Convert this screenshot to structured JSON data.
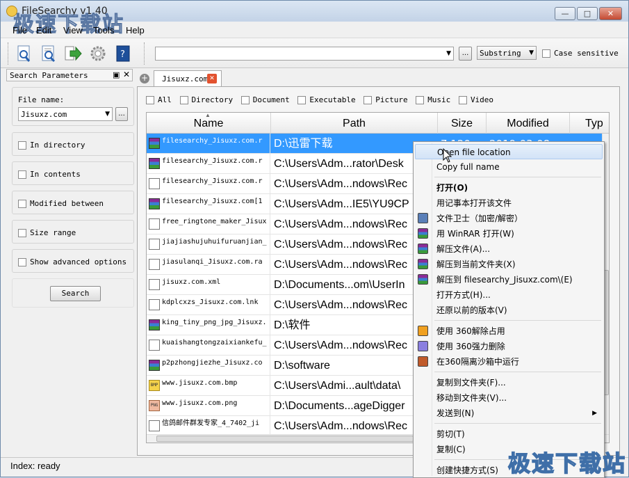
{
  "window": {
    "title": "FileSearchy v1.40",
    "watermark": "极速下载站",
    "buttons": {
      "minimize": "—",
      "maximize": "□",
      "close": "✕"
    }
  },
  "menu": [
    "File",
    "Edit",
    "View",
    "Tools",
    "Help"
  ],
  "toolbar": {
    "icons": [
      "search-file-icon",
      "search-content-icon",
      "export-arrow-icon",
      "settings-gear-icon",
      "help-book-icon"
    ],
    "search_value": "",
    "browse_label": "...",
    "match_mode": "Substring",
    "case_sensitive_label": "Case sensitive"
  },
  "left_panel": {
    "header": "Search Parameters",
    "file_name_label": "File name:",
    "file_name_value": "Jisuxz.com",
    "browse_label": "...",
    "options": [
      "In directory",
      "In contents",
      "Modified between",
      "Size range",
      "Show advanced options"
    ],
    "search_button": "Search"
  },
  "tabs": {
    "add_label": "+",
    "active_tab": "Jisuxz.com",
    "close_label": "✕"
  },
  "filters": [
    "All",
    "Directory",
    "Document",
    "Executable",
    "Picture",
    "Music",
    "Video"
  ],
  "columns": {
    "name": "Name",
    "path": "Path",
    "size": "Size",
    "modified": "Modified",
    "type": "Typ"
  },
  "rows": [
    {
      "name": "filesearchy_Jisuxz.com.r",
      "path": "D:\\迅雷下载",
      "size": "7,120",
      "modified": "2019-03-08",
      "icon": "rar"
    },
    {
      "name": "filesearchy_Jisuxz.com.r",
      "path": "C:\\Users\\Adm...rator\\Desk",
      "size": "",
      "modified": "",
      "icon": "rar"
    },
    {
      "name": "filesearchy_Jisuxz.com.r",
      "path": "C:\\Users\\Adm...ndows\\Rec",
      "size": "",
      "modified": "",
      "icon": "lnk"
    },
    {
      "name": "filesearchy_Jisuxz.com[1",
      "path": "C:\\Users\\Adm...IE5\\YU9CP",
      "size": "",
      "modified": "",
      "icon": "rar"
    },
    {
      "name": "free_ringtone_maker_Jisux",
      "path": "C:\\Users\\Adm...ndows\\Rec",
      "size": "",
      "modified": "",
      "icon": "lnk"
    },
    {
      "name": "jiajiashujuhuifuruanjian_",
      "path": "C:\\Users\\Adm...ndows\\Rec",
      "size": "",
      "modified": "",
      "icon": "lnk"
    },
    {
      "name": "jiasulanqi_Jisuxz.com.ra",
      "path": "C:\\Users\\Adm...ndows\\Rec",
      "size": "",
      "modified": "",
      "icon": "lnk"
    },
    {
      "name": "jisuxz.com.xml",
      "path": "D:\\Documents...om\\UserIn",
      "size": "",
      "modified": "",
      "icon": "xml"
    },
    {
      "name": "kdplcxzs_Jisuxz.com.lnk",
      "path": "C:\\Users\\Adm...ndows\\Rec",
      "size": "",
      "modified": "",
      "icon": "lnk"
    },
    {
      "name": "king_tiny_png_jpg_Jisuxz.",
      "path": "D:\\软件",
      "size": "",
      "modified": "",
      "icon": "rar"
    },
    {
      "name": "kuaishangtongzaixiankefu_",
      "path": "C:\\Users\\Adm...ndows\\Rec",
      "size": "",
      "modified": "",
      "icon": "lnk"
    },
    {
      "name": "p2pzhongjiezhe_Jisuxz.co",
      "path": "D:\\software",
      "size": "",
      "modified": "",
      "icon": "rar"
    },
    {
      "name": "www.jisuxz.com.bmp",
      "path": "C:\\Users\\Admi...ault\\data\\",
      "size": "",
      "modified": "",
      "icon": "bmp"
    },
    {
      "name": "www.jisuxz.com.png",
      "path": "D:\\Documents...ageDigger",
      "size": "",
      "modified": "",
      "icon": "png"
    },
    {
      "name": "信鸽邮件群发专家_4_7402_ji",
      "path": "C:\\Users\\Adm...ndows\\Rec",
      "size": "",
      "modified": "",
      "icon": "lnk"
    }
  ],
  "status": "Index: ready",
  "context_menu": [
    {
      "label": "Open file location",
      "icon": "",
      "hover": true
    },
    {
      "label": "Copy full name",
      "icon": ""
    },
    {
      "sep": true
    },
    {
      "label": "打开(O)",
      "icon": "",
      "bold": true
    },
    {
      "label": "用记事本打开该文件",
      "icon": ""
    },
    {
      "label": "文件卫士（加密/解密）",
      "icon": "shield-icon"
    },
    {
      "label": "用 WinRAR 打开(W)",
      "icon": "winrar-icon"
    },
    {
      "label": "解压文件(A)...",
      "icon": "winrar-icon"
    },
    {
      "label": "解压到当前文件夹(X)",
      "icon": "winrar-icon"
    },
    {
      "label": "解压到 filesearchy_Jisuxz.com\\(E)",
      "icon": "winrar-icon"
    },
    {
      "label": "打开方式(H)...",
      "icon": ""
    },
    {
      "label": "还原以前的版本(V)",
      "icon": ""
    },
    {
      "sep": true
    },
    {
      "label": "使用 360解除占用",
      "icon": "360-unlock-icon"
    },
    {
      "label": "使用 360强力删除",
      "icon": "360-delete-icon"
    },
    {
      "label": "在360隔离沙箱中运行",
      "icon": "360-sandbox-icon"
    },
    {
      "sep": true
    },
    {
      "label": "复制到文件夹(F)...",
      "icon": ""
    },
    {
      "label": "移动到文件夹(V)...",
      "icon": ""
    },
    {
      "label": "发送到(N)",
      "icon": "",
      "submenu": true
    },
    {
      "sep": true
    },
    {
      "label": "剪切(T)",
      "icon": ""
    },
    {
      "label": "复制(C)",
      "icon": ""
    },
    {
      "sep": true
    },
    {
      "label": "创建快捷方式(S)",
      "icon": ""
    }
  ]
}
